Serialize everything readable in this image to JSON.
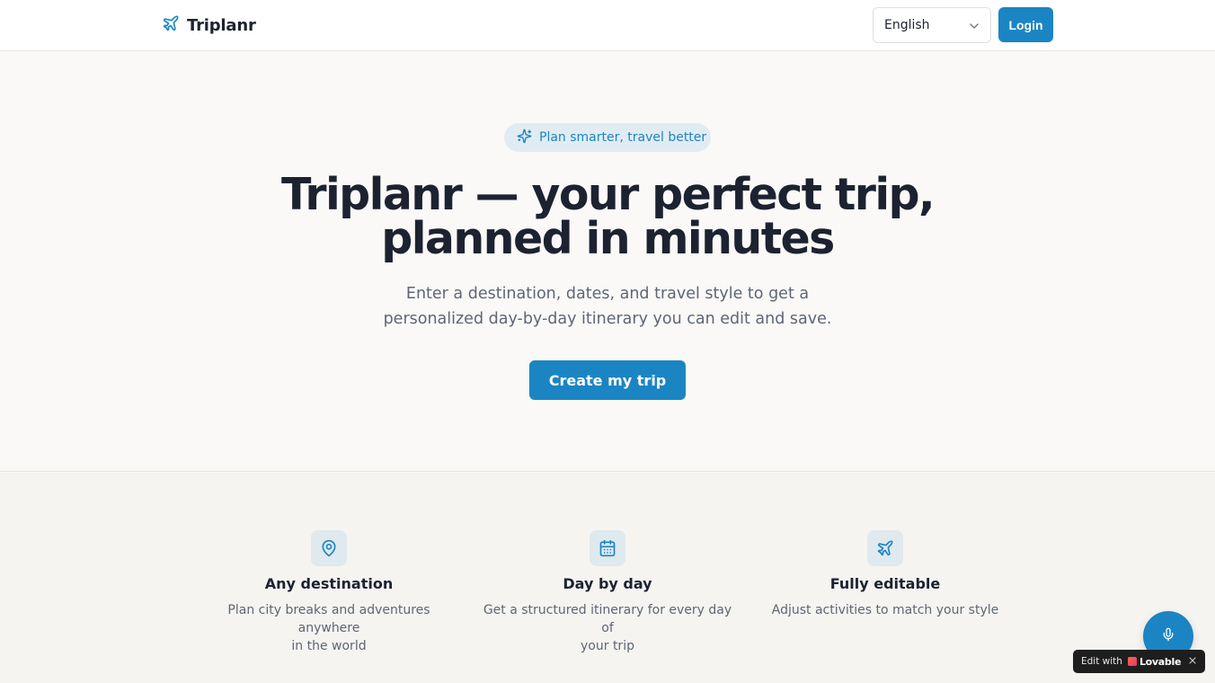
{
  "header": {
    "brand": "Triplanr",
    "language": {
      "selected": "English"
    },
    "login_label": "Login"
  },
  "hero": {
    "badge": "Plan smarter, travel better",
    "title_line1": "Triplanr — your perfect trip,",
    "title_line2": "planned in minutes",
    "subtitle_line1": "Enter a destination, dates, and travel style to get a",
    "subtitle_line2": "personalized day-by-day itinerary you can edit and save.",
    "cta_label": "Create my trip"
  },
  "features": [
    {
      "icon": "map-pin-icon",
      "title": "Any destination",
      "desc_line1": "Plan city breaks and adventures anywhere",
      "desc_line2": "in the world"
    },
    {
      "icon": "calendar-icon",
      "title": "Day by day",
      "desc_line1": "Get a structured itinerary for every day of",
      "desc_line2": "your trip"
    },
    {
      "icon": "plane-icon",
      "title": "Fully editable",
      "desc_line1": "Adjust activities to match your style",
      "desc_line2": ""
    }
  ],
  "floating": {
    "mic_icon": "microphone-icon"
  },
  "lovable_badge": {
    "prefix": "Edit with",
    "brand": "Lovable"
  },
  "colors": {
    "accent": "#1b85c3",
    "text": "#1c2230",
    "muted": "#5e6675",
    "page_bg": "#faf9f7"
  }
}
